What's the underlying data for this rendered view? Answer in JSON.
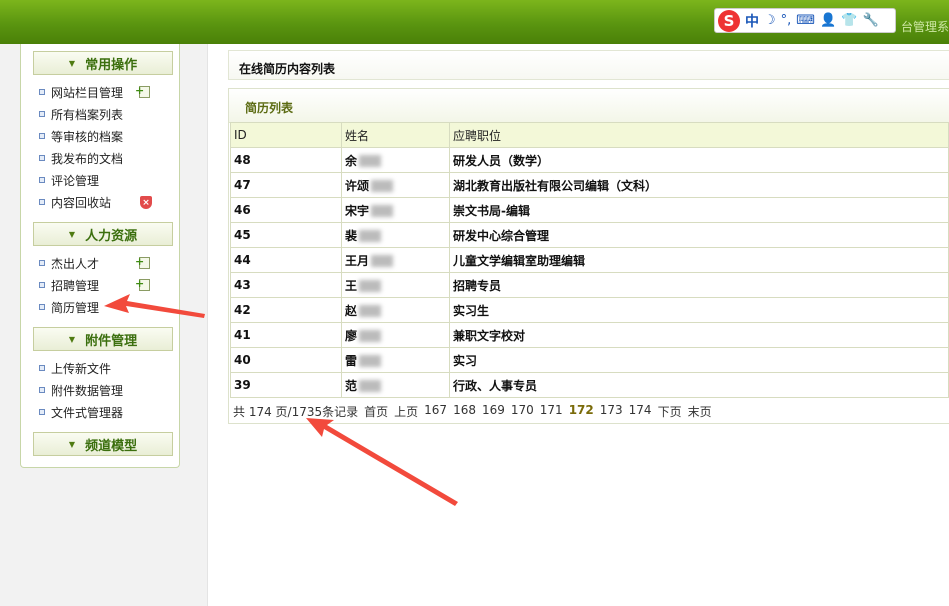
{
  "topbar": {
    "title": "台管理系"
  },
  "ime": {
    "logo": "S",
    "mode": "中",
    "moon": "☽",
    "punct": "°,",
    "keyboard": "⌨",
    "user": "👤",
    "skin": "👕",
    "tools": "🔧"
  },
  "sidebar": {
    "sections": [
      {
        "label": "常用操作",
        "items": [
          "网站栏目管理",
          "所有档案列表",
          "等审核的档案",
          "我发布的文档",
          "评论管理",
          "内容回收站"
        ]
      },
      {
        "label": "人力资源",
        "items": [
          "杰出人才",
          "招聘管理",
          "简历管理"
        ]
      },
      {
        "label": "附件管理",
        "items": [
          "上传新文件",
          "附件数据管理",
          "文件式管理器"
        ]
      },
      {
        "label": "频道模型",
        "items": []
      }
    ]
  },
  "main": {
    "title": "在线简历内容列表",
    "list_title": "简历列表",
    "columns": [
      "ID",
      "姓名",
      "应聘职位"
    ],
    "rows": [
      {
        "id": "48",
        "name": "余",
        "position": "研发人员（数学）"
      },
      {
        "id": "47",
        "name": "许颂",
        "position": "湖北教育出版社有限公司编辑（文科）"
      },
      {
        "id": "46",
        "name": "宋宇",
        "position": "崇文书局-编辑"
      },
      {
        "id": "45",
        "name": "裴",
        "position": "研发中心综合管理"
      },
      {
        "id": "44",
        "name": "王月",
        "position": "儿童文学编辑室助理编辑"
      },
      {
        "id": "43",
        "name": "王",
        "position": "招聘专员"
      },
      {
        "id": "42",
        "name": "赵",
        "position": "实习生"
      },
      {
        "id": "41",
        "name": "廖",
        "position": "兼职文字校对"
      },
      {
        "id": "40",
        "name": "雷",
        "position": "实习"
      },
      {
        "id": "39",
        "name": "范",
        "position": "行政、人事专员"
      }
    ],
    "pager": {
      "summary": "共 174 页/1735条记录",
      "first": "首页",
      "prev": "上页",
      "pages": [
        "167",
        "168",
        "169",
        "170",
        "171",
        "172",
        "173",
        "174"
      ],
      "current": "172",
      "next": "下页",
      "last": "末页"
    }
  },
  "colors": {
    "topbar": "#5a9510",
    "arrow": "#f24a3c",
    "section_text": "#3b6f0e"
  }
}
